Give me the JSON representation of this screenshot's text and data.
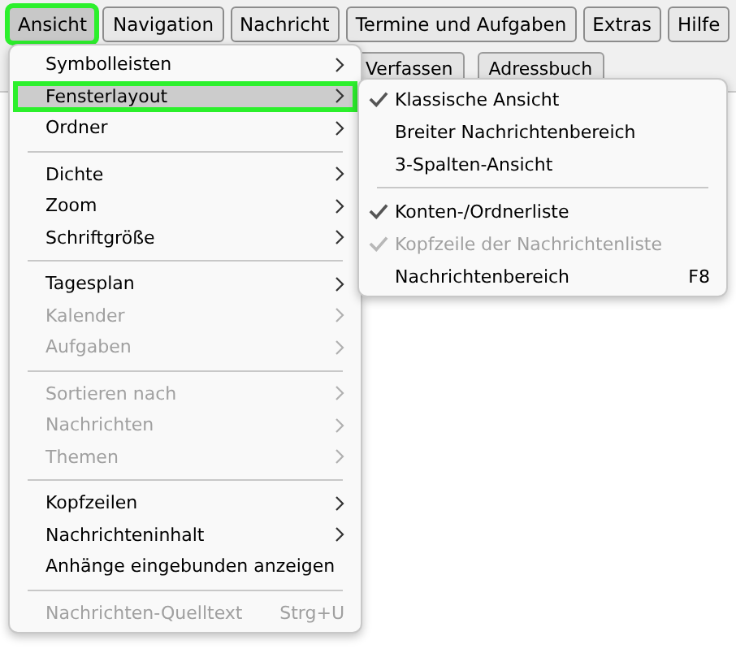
{
  "menu_bar": [
    {
      "label": "Ansicht",
      "selected": true
    },
    {
      "label": "Navigation",
      "selected": false
    },
    {
      "label": "Nachricht",
      "selected": false
    },
    {
      "label": "Termine und Aufgaben",
      "selected": false
    },
    {
      "label": "Extras",
      "selected": false
    },
    {
      "label": "Hilfe",
      "selected": false
    }
  ],
  "toolbar": [
    {
      "label": "Verfassen"
    },
    {
      "label": "Adressbuch"
    }
  ],
  "view_menu": [
    {
      "kind": "submenu",
      "label": "Symbolleisten",
      "disabled": false,
      "selected": false
    },
    {
      "kind": "submenu",
      "label": "Fensterlayout",
      "disabled": false,
      "selected": true
    },
    {
      "kind": "submenu",
      "label": "Ordner",
      "disabled": false,
      "selected": false
    },
    {
      "kind": "separator"
    },
    {
      "kind": "submenu",
      "label": "Dichte",
      "disabled": false,
      "selected": false
    },
    {
      "kind": "submenu",
      "label": "Zoom",
      "disabled": false,
      "selected": false
    },
    {
      "kind": "submenu",
      "label": "Schriftgröße",
      "disabled": false,
      "selected": false
    },
    {
      "kind": "separator"
    },
    {
      "kind": "submenu",
      "label": "Tagesplan",
      "disabled": false,
      "selected": false
    },
    {
      "kind": "submenu",
      "label": "Kalender",
      "disabled": true,
      "selected": false
    },
    {
      "kind": "submenu",
      "label": "Aufgaben",
      "disabled": true,
      "selected": false
    },
    {
      "kind": "separator"
    },
    {
      "kind": "submenu",
      "label": "Sortieren nach",
      "disabled": true,
      "selected": false
    },
    {
      "kind": "submenu",
      "label": "Nachrichten",
      "disabled": true,
      "selected": false
    },
    {
      "kind": "submenu",
      "label": "Themen",
      "disabled": true,
      "selected": false
    },
    {
      "kind": "separator"
    },
    {
      "kind": "submenu",
      "label": "Kopfzeilen",
      "disabled": false,
      "selected": false
    },
    {
      "kind": "submenu",
      "label": "Nachrichteninhalt",
      "disabled": false,
      "selected": false
    },
    {
      "kind": "command",
      "label": "Anhänge eingebunden anzeigen",
      "disabled": false,
      "selected": false
    },
    {
      "kind": "separator"
    },
    {
      "kind": "command",
      "label": "Nachrichten-Quelltext",
      "shortcut": "Strg+U",
      "disabled": true,
      "selected": false
    }
  ],
  "layout_submenu": [
    {
      "kind": "command",
      "label": "Klassische Ansicht",
      "checked": true,
      "disabled": false
    },
    {
      "kind": "command",
      "label": "Breiter Nachrichtenbereich",
      "checked": false,
      "disabled": false
    },
    {
      "kind": "command",
      "label": "3-Spalten-Ansicht",
      "checked": false,
      "disabled": false
    },
    {
      "kind": "separator"
    },
    {
      "kind": "command",
      "label": "Konten-/Ordnerliste",
      "checked": true,
      "disabled": false
    },
    {
      "kind": "command",
      "label": "Kopfzeile der Nachrichtenliste",
      "checked": true,
      "disabled": true
    },
    {
      "kind": "command",
      "label": "Nachrichtenbereich",
      "shortcut": "F8",
      "checked": false,
      "disabled": false
    }
  ]
}
